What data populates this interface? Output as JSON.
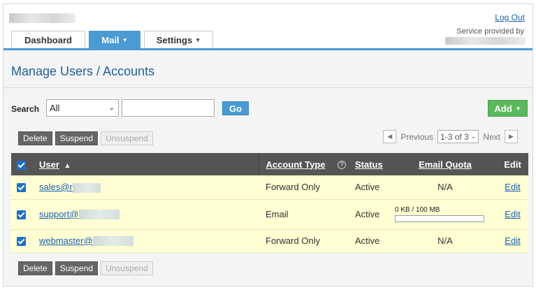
{
  "header": {
    "logout_label": "Log Out",
    "provided_label": "Service provided by"
  },
  "tabs": [
    {
      "label": "Dashboard",
      "caret": ""
    },
    {
      "label": "Mail",
      "caret": "▼"
    },
    {
      "label": "Settings",
      "caret": "▼"
    }
  ],
  "page": {
    "title": "Manage Users / Accounts"
  },
  "search": {
    "label": "Search",
    "filter_value": "All",
    "input_value": "",
    "go_label": "Go"
  },
  "add": {
    "label": "Add",
    "caret": "▼"
  },
  "actions": {
    "delete_label": "Delete",
    "suspend_label": "Suspend",
    "unsuspend_label": "Unsuspend"
  },
  "pager": {
    "prev_label": "Previous",
    "next_label": "Next",
    "range_value": "1-3 of 3",
    "prev_icon": "◀",
    "next_icon": "▶"
  },
  "table": {
    "headers": {
      "user": "User",
      "sort_icon": "▲",
      "account_type": "Account Type",
      "help_icon": "?",
      "status": "Status",
      "email_quota": "Email Quota",
      "edit": "Edit"
    },
    "rows": [
      {
        "user": "sales@r",
        "account_type": "Forward Only",
        "status": "Active",
        "quota": "N/A",
        "quota_used_fraction": null,
        "edit": "Edit"
      },
      {
        "user": "support@",
        "account_type": "Email",
        "status": "Active",
        "quota": "0 KB / 100 MB",
        "quota_used_fraction": 0,
        "edit": "Edit"
      },
      {
        "user": "webmaster@",
        "account_type": "Forward Only",
        "status": "Active",
        "quota": "N/A",
        "quota_used_fraction": null,
        "edit": "Edit"
      }
    ]
  },
  "colors": {
    "accent_blue": "#4a9ad4",
    "add_green": "#5cb85c",
    "row_highlight": "#ffffd3",
    "header_dark": "#555555",
    "title_blue": "#1f5f99"
  }
}
